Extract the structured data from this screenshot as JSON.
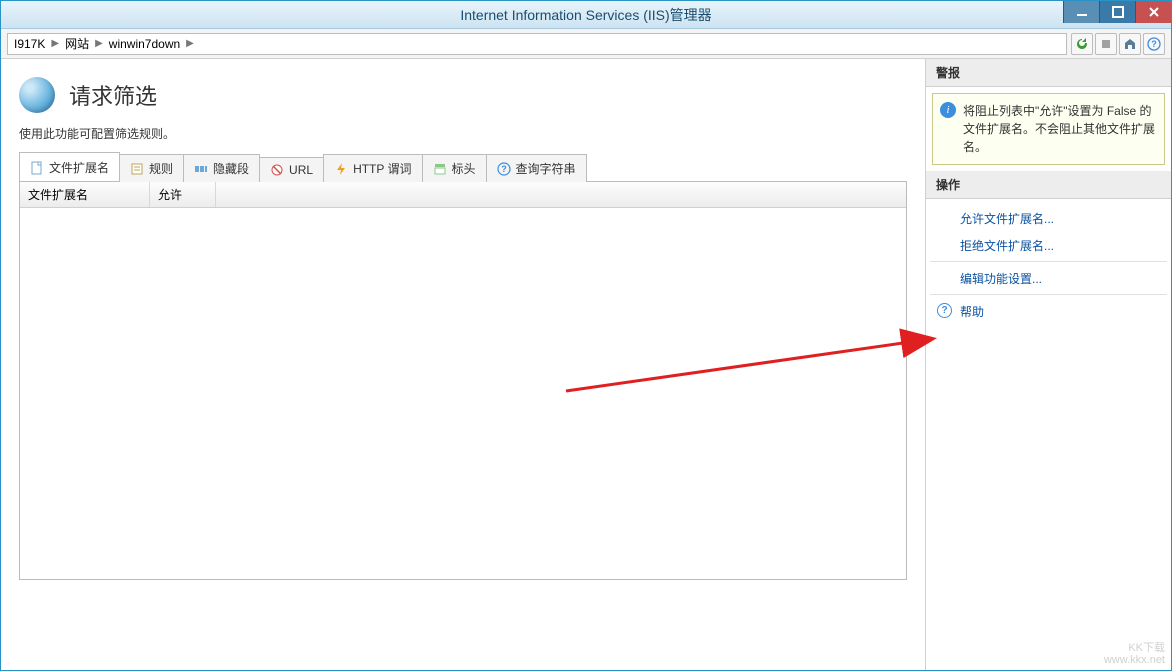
{
  "window": {
    "title": "Internet Information Services (IIS)管理器"
  },
  "breadcrumb": {
    "item1": "I917K",
    "item2": "网站",
    "item3": "winwin7down"
  },
  "main": {
    "title": "请求筛选",
    "desc": "使用此功能可配置筛选规则。"
  },
  "tabs": {
    "t0": "文件扩展名",
    "t1": "规则",
    "t2": "隐藏段",
    "t3": "URL",
    "t4": "HTTP 谓词",
    "t5": "标头",
    "t6": "查询字符串"
  },
  "columns": {
    "c1": "文件扩展名",
    "c2": "允许"
  },
  "sidebar": {
    "alerts_head": "警报",
    "alert_text": "将阻止列表中\"允许\"设置为 False 的文件扩展名。不会阻止其他文件扩展名。",
    "actions_head": "操作",
    "a0": "允许文件扩展名...",
    "a1": "拒绝文件扩展名...",
    "a2": "编辑功能设置...",
    "a3": "帮助"
  },
  "watermark": {
    "l1": "KK下载",
    "l2": "www.kkx.net"
  }
}
